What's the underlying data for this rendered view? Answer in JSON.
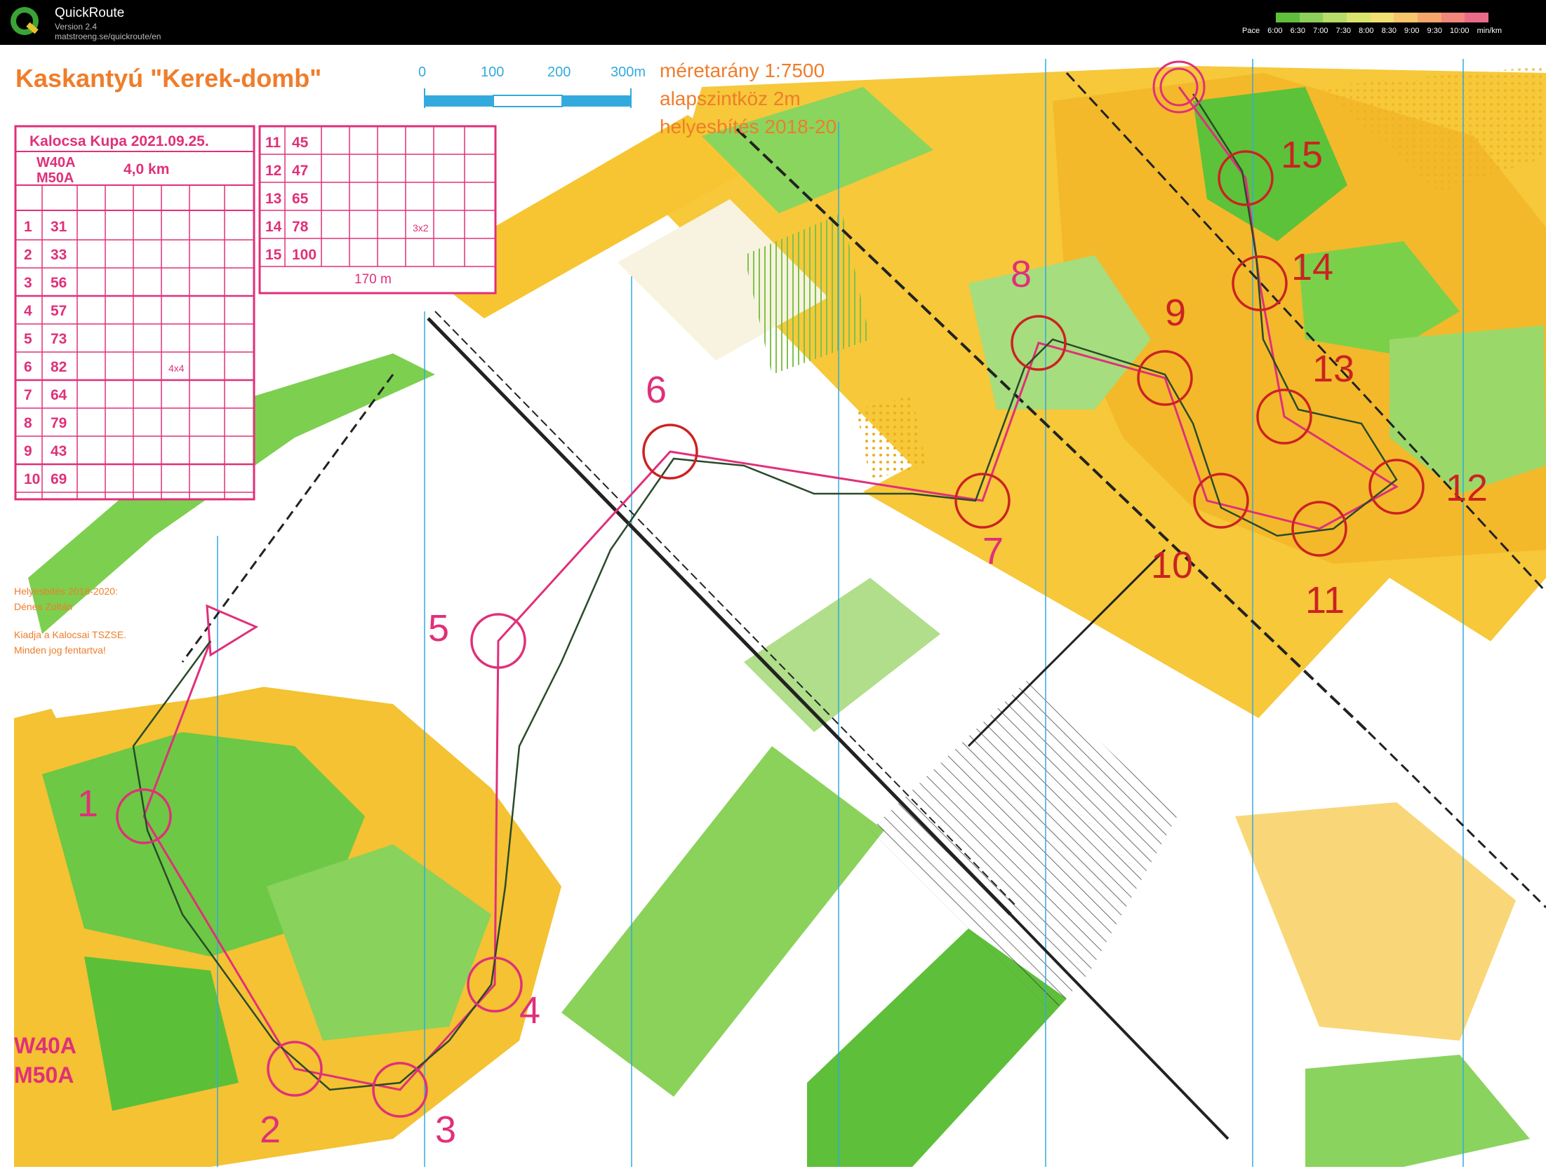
{
  "app": {
    "name": "QuickRoute",
    "version": "Version 2.4",
    "url": "matstroeng.se/quickroute/en",
    "logo_letter": "Q"
  },
  "pace_legend": {
    "label": "Pace",
    "ticks": [
      "6:00",
      "6:30",
      "7:00",
      "7:30",
      "8:00",
      "8:30",
      "9:00",
      "9:30",
      "10:00"
    ],
    "unit": "min/km",
    "colors": [
      "#5fbf3a",
      "#8ccf5a",
      "#b6dc6a",
      "#d9e46e",
      "#f2e070",
      "#f7c56a",
      "#f7a66a",
      "#f2877a",
      "#e96b8a"
    ]
  },
  "map": {
    "title": "Kaskantyú \"Kerek-domb\"",
    "scale_bar": {
      "labels": [
        "0",
        "100",
        "200",
        "300m"
      ]
    },
    "map_info": [
      "méretarány  1:7500",
      "alapszintköz  2m",
      "helyesbítés  2018-20"
    ],
    "credits": [
      "Helyesbítés 2018-2020:",
      "Dénes Zoltán",
      "Kiadja a Kalocsai TSZSE.",
      "Minden jog fentartva!"
    ],
    "class_label": [
      "W40A",
      "M50A"
    ],
    "control_description": {
      "event": "Kalocsa Kupa 2021.09.25.",
      "classes": "W40A\nM50A",
      "length": "4,0 km",
      "rows": [
        {
          "n": "1",
          "code": "31",
          "extra": ""
        },
        {
          "n": "2",
          "code": "33",
          "extra": ""
        },
        {
          "n": "3",
          "code": "56",
          "extra": ""
        },
        {
          "n": "4",
          "code": "57",
          "extra": ""
        },
        {
          "n": "5",
          "code": "73",
          "extra": ""
        },
        {
          "n": "6",
          "code": "82",
          "extra": "4x4"
        },
        {
          "n": "7",
          "code": "64",
          "extra": ""
        },
        {
          "n": "8",
          "code": "79",
          "extra": ""
        },
        {
          "n": "9",
          "code": "43",
          "extra": ""
        },
        {
          "n": "10",
          "code": "69",
          "extra": ""
        },
        {
          "n": "11",
          "code": "45",
          "extra": ""
        },
        {
          "n": "12",
          "code": "47",
          "extra": ""
        },
        {
          "n": "13",
          "code": "65",
          "extra": ""
        },
        {
          "n": "14",
          "code": "78",
          "extra": "3x2"
        },
        {
          "n": "15",
          "code": "100",
          "extra": ""
        }
      ],
      "finish_distance": "170 m"
    },
    "controls": [
      "1",
      "2",
      "3",
      "4",
      "5",
      "6",
      "7",
      "8",
      "9",
      "10",
      "11",
      "12",
      "13",
      "14",
      "15"
    ],
    "colors": {
      "course": "#e0307a",
      "forest_green": "#5cc23a",
      "light_green": "#b7e29b",
      "yellow": "#f7c531",
      "route": "#2a4a2a",
      "blue_line": "#33aadd",
      "route_red": "#cc2222"
    }
  }
}
